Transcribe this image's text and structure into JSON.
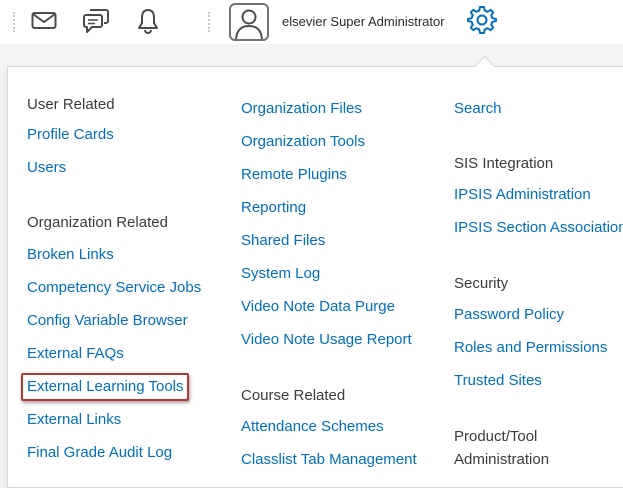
{
  "user": {
    "name": "elsevier Super Administrator"
  },
  "icons": {
    "email": "email-icon",
    "messages": "message-icon",
    "notifications": "bell-icon",
    "avatar": "user-avatar-icon",
    "admin_tools": "gear-icon"
  },
  "colors": {
    "link": "#006fbf",
    "heading": "#3a3b3c",
    "highlight_border": "#b5392f",
    "gear": "#006fbf"
  },
  "menu": {
    "col1": {
      "user_related": "User Related",
      "profile_cards": "Profile Cards",
      "users": "Users",
      "org_related": "Organization Related",
      "broken_links": "Broken Links",
      "competency_jobs": "Competency Service Jobs",
      "config_browser": "Config Variable Browser",
      "external_faqs": "External FAQs",
      "external_learning_tools": "External Learning Tools",
      "external_links": "External Links",
      "final_grade_audit": "Final Grade Audit Log"
    },
    "col2": {
      "org_files": "Organization Files",
      "org_tools": "Organization Tools",
      "remote_plugins": "Remote Plugins",
      "reporting": "Reporting",
      "shared_files": "Shared Files",
      "system_log": "System Log",
      "video_note_purge": "Video Note Data Purge",
      "video_note_usage": "Video Note Usage Report",
      "course_related": "Course Related",
      "attendance_schemes": "Attendance Schemes",
      "classlist_tab": "Classlist Tab Management"
    },
    "col3": {
      "search": "Search",
      "sis_integration": "SIS Integration",
      "ipsis_admin": "IPSIS Administration",
      "ipsis_section": "IPSIS Section Associations",
      "security": "Security",
      "password_policy": "Password Policy",
      "roles_permissions": "Roles and Permissions",
      "trusted_sites": "Trusted Sites",
      "product_tool": "Product/Tool",
      "administration": "Administration"
    }
  }
}
